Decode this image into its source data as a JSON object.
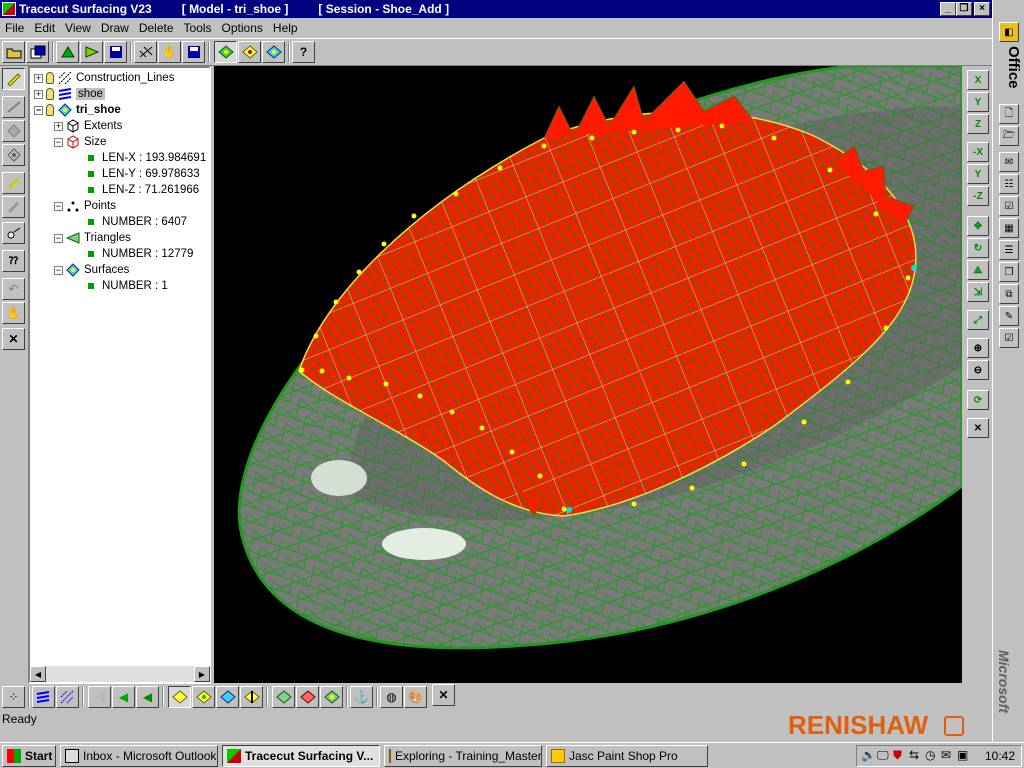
{
  "window": {
    "app_title": "Tracecut Surfacing V23",
    "model_title": "[ Model - tri_shoe ]",
    "session_title": "[ Session - Shoe_Add ]"
  },
  "menu": [
    "File",
    "Edit",
    "View",
    "Draw",
    "Delete",
    "Tools",
    "Options",
    "Help"
  ],
  "tree": {
    "construction_lines": "Construction_Lines",
    "shoe": "shoe",
    "tri_shoe": "tri_shoe",
    "extents": "Extents",
    "size": "Size",
    "len_x": "LEN-X : 193.984691",
    "len_y": "LEN-Y : 69.978633",
    "len_z": "LEN-Z : 71.261966",
    "points": "Points",
    "points_number": "NUMBER : 6407",
    "triangles": "Triangles",
    "triangles_number": "NUMBER : 12779",
    "surfaces": "Surfaces",
    "surfaces_number": "NUMBER : 1"
  },
  "right_toolbar": [
    "X",
    "Y",
    "Z",
    "-X",
    "Y",
    "-Z"
  ],
  "status": {
    "text": "Ready"
  },
  "brand": {
    "logo": "RENISHAW",
    "color": "#e06010"
  },
  "office_bar": {
    "label": "Office",
    "vendor": "Microsoft"
  },
  "taskbar": {
    "start": "Start",
    "tasks": [
      "Inbox - Microsoft Outlook",
      "Tracecut Surfacing V...",
      "Exploring - Training_Master",
      "Jasc Paint Shop Pro"
    ],
    "clock": "10:42"
  },
  "colors": {
    "titlebar": "#000080",
    "mesh": "#1a8a1a",
    "surface": "#ff1a00"
  }
}
